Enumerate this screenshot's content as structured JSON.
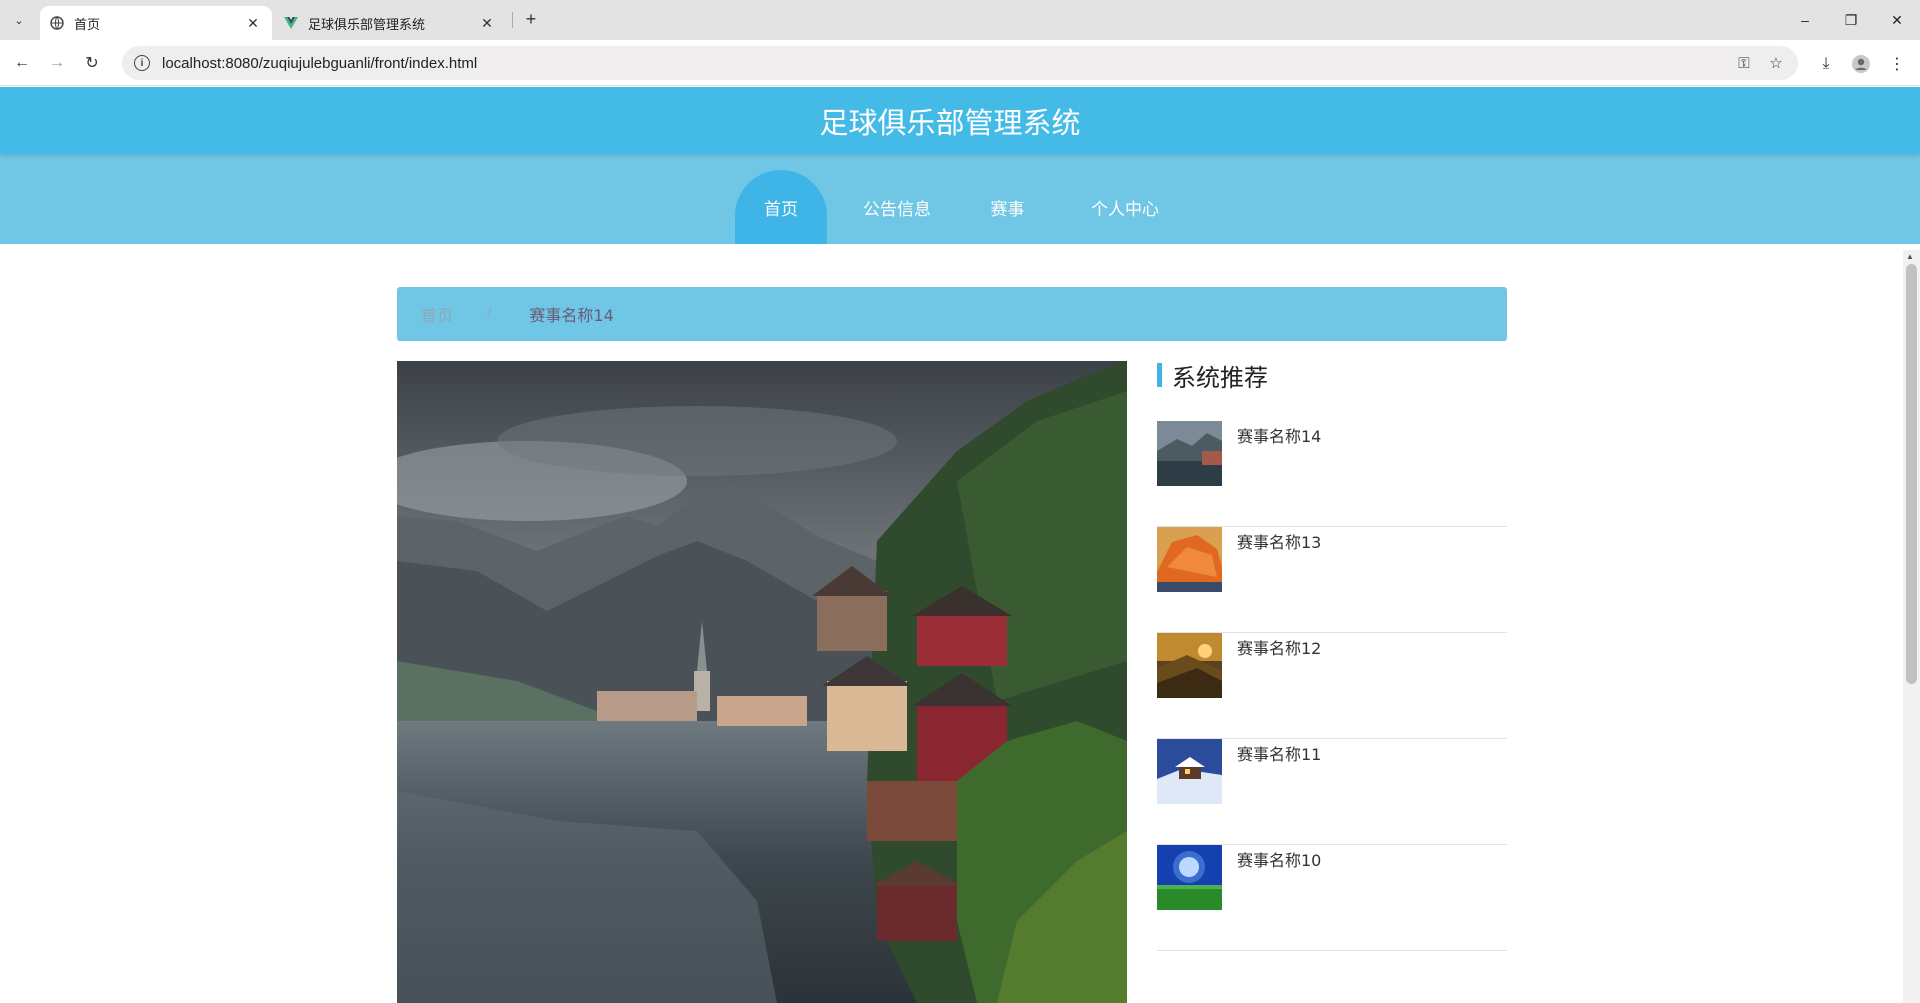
{
  "browser": {
    "tabs": [
      {
        "title": "首页",
        "active": true
      },
      {
        "title": "足球俱乐部管理系统",
        "active": false
      }
    ],
    "url": "localhost:8080/zuqiujulebguanli/front/index.html",
    "window_controls": {
      "minimize": "–",
      "restore": "❐",
      "close": "✕"
    }
  },
  "site": {
    "title": "足球俱乐部管理系统",
    "nav": [
      {
        "label": "首页",
        "active": true
      },
      {
        "label": "公告信息",
        "active": false
      },
      {
        "label": "赛事",
        "active": false
      },
      {
        "label": "个人中心",
        "active": false
      }
    ]
  },
  "breadcrumb": {
    "home": "首页",
    "separator": "/",
    "current": "赛事名称14"
  },
  "recommend": {
    "title": "系统推荐",
    "items": [
      {
        "name": "赛事名称14",
        "thumb": "mountain-lake"
      },
      {
        "name": "赛事名称13",
        "thumb": "orange-rock"
      },
      {
        "name": "赛事名称12",
        "thumb": "sunset-hills"
      },
      {
        "name": "赛事名称11",
        "thumb": "snow-cabin"
      },
      {
        "name": "赛事名称10",
        "thumb": "blue-sky-field"
      }
    ]
  },
  "colors": {
    "header": "#44bae6",
    "nav": "#6fc7e5",
    "nav_active": "#3fb5e7",
    "accent_bar": "#3db4e4"
  }
}
